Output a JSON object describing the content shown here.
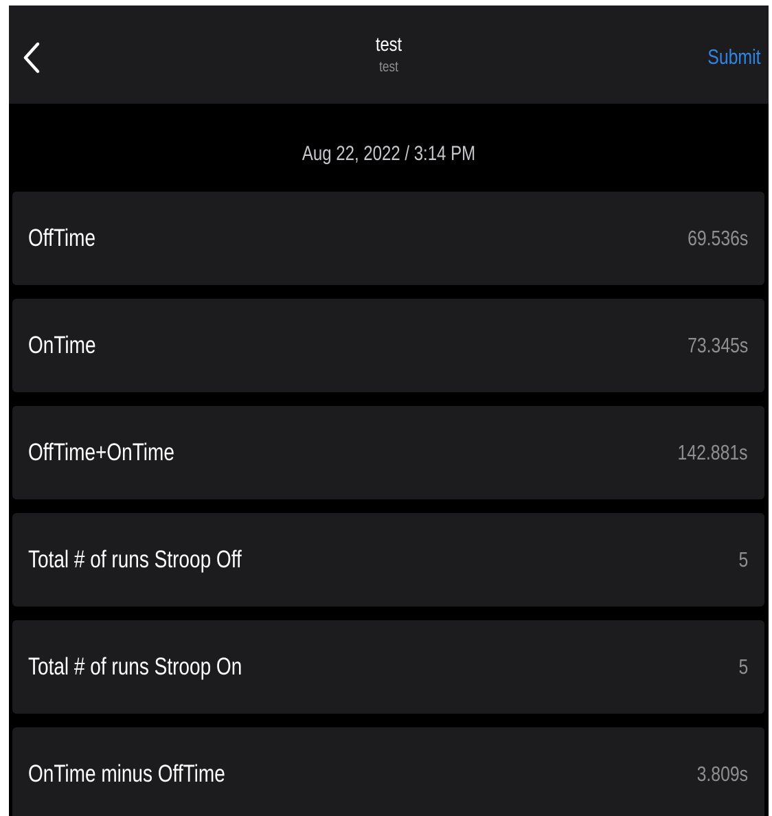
{
  "navbar": {
    "title": "test",
    "subtitle": "test",
    "submit_label": "Submit",
    "back_icon": "chevron-left-icon",
    "accent_color": "#2f86e6"
  },
  "date_header": "Aug 22, 2022 / 3:14 PM",
  "rows": [
    {
      "label": "OffTime",
      "value": "69.536s"
    },
    {
      "label": "OnTime",
      "value": "73.345s"
    },
    {
      "label": "OffTime+OnTime",
      "value": "142.881s"
    },
    {
      "label": "Total # of runs Stroop Off",
      "value": "5"
    },
    {
      "label": "Total # of runs Stroop On",
      "value": "5"
    },
    {
      "label": "OnTime minus OffTime",
      "value": "3.809s"
    }
  ]
}
